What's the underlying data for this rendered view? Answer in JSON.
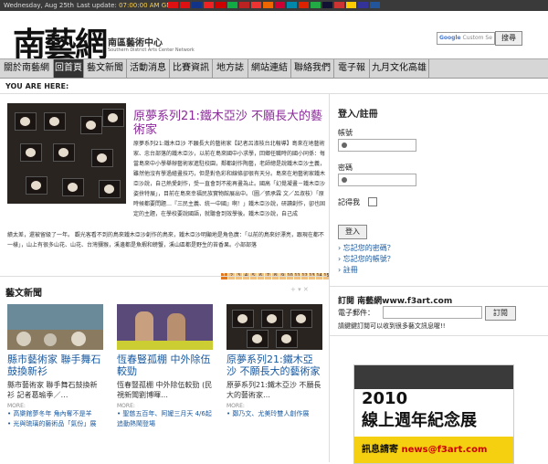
{
  "topbar": {
    "date": "Wednesday, Aug 25th",
    "last_update_label": "Last update:",
    "last_update_time": "07:00:00 AM GMT"
  },
  "flags": [
    "#d11",
    "#d11",
    "#138",
    "#e22",
    "#c00",
    "#1a4",
    "#b22",
    "#e33",
    "#e60",
    "#c03",
    "#08a",
    "#d20",
    "#2a4",
    "#113",
    "#c33",
    "#fc0",
    "#339",
    "#259"
  ],
  "header": {
    "logo_cn": "南藝網",
    "logo_sub": "南區藝術中心",
    "logo_en": "Southern District Arts Center Network",
    "search_placeholder_google": "Google",
    "search_placeholder_rest": " Custom Se",
    "search_button": "搜尋"
  },
  "nav": [
    {
      "label": "關於南藝網",
      "active": false
    },
    {
      "label": "回首頁",
      "active": true
    },
    {
      "label": "藝文新聞",
      "active": false
    },
    {
      "label": "活動消息",
      "active": false
    },
    {
      "label": "比賽資訊",
      "active": false
    },
    {
      "label": "地方誌",
      "active": false
    },
    {
      "label": "網站連結",
      "active": false
    },
    {
      "label": "聯絡我們",
      "active": false
    },
    {
      "label": "電子報",
      "active": false
    },
    {
      "label": "九月文化高雄",
      "active": false
    }
  ],
  "you_are_here": "YOU ARE HERE:",
  "feature": {
    "title": "原夢系列21:鐵木亞沙 不願長大的藝術家",
    "text": "原夢系列21:鐵木亞沙 不願長大的藝術家【記者呂淑枝台北報導】島來在地藝術家、忠台部落的鐵木亞沙，以前在島來國中小求學，回鄉任職時的國小同係：每當島來中小學舉辦藝術家進駐校園，鄰都創作陶藝，老師總是說鐵木亞沙主義，雖然他沒有學過繪畫技巧，但是對色彩和線條卻很有天分。島來在地藝術家鐵木亞沙說，自己熱愛創作，受一直會到不能再畫為止。國高「幻覺凝畫－鐵木亞沙姿拚特展」，目前在島來幸福民族實物館展出中。（圖／張承霖 文／呂淑枝）「原時候都要問題…『三民主義、統一中國』啊！」鐵木亞沙說，研讀創作，卻也固定的主題，在學校要說國語，就聽會到效學後。鐵木亞沙說，自己成",
    "text2": "績太差，還被留級了一年。 觀光客看不到的鳥來鐵木亞沙創作的鳥來，鐵木亞沙明顯地是角色廣：「以前的鳥來好漂亮，跟現在都不一樣」，山上有很多山花、山花、台灣獼猴，溪邊都是魚蝦和螃蟹，溪山區都是野生的苔香果。小部部落"
  },
  "pager": [
    "1",
    "2",
    "3",
    "4",
    "5",
    "6",
    "7",
    "8",
    "9",
    "10",
    "11",
    "12",
    "13",
    "14",
    "15"
  ],
  "news": {
    "title": "藝文新聞",
    "controls": "+ ▾ ✕",
    "items": [
      {
        "title": "縣市藝術家 聯手舞石鼓換新衫",
        "desc": "縣市藝術家 聯手舞石鼓換新衫 記者葛瑜季／…",
        "more": "MORE:",
        "links": [
          "高樂館夢冬年 角內奪不是羊",
          "光與琉璃的藝術品「氣份」展"
        ]
      },
      {
        "title": "恆春豎孤棚 中外除伍較勁",
        "desc": "恆春豎孤棚 中外除伍較勁 (民視新聞劉博暉…",
        "more": "MORE:",
        "links": [
          "聖慈五百年、阿嬤三月天 4/6起追動熱鬧登場",
          ""
        ]
      },
      {
        "title": "原夢系列21:鐵木亞沙 不願長大的藝術家",
        "desc": "原夢系列21:鐵木亞沙 不願長大的藝術家…",
        "more": "MORE:",
        "links": [
          "鄭乃文、尤美玲雙人創作展",
          ""
        ]
      }
    ]
  },
  "login": {
    "title": "登入/註冊",
    "account_label": "帳號",
    "password_label": "密碼",
    "remember_label": "記得我",
    "login_button": "登入",
    "links": [
      "忘記您的密碼？",
      "忘記您的帳號？",
      "註冊"
    ]
  },
  "subscribe": {
    "title": "訂閱 南藝網www.f3art.com",
    "email_label": "電子郵件：",
    "button": "訂閱",
    "note": "請鍵鍵訂閱可以收到很多藝文訊息喔!!"
  },
  "ad": {
    "year": "2010",
    "headline": "線上週年紀念展",
    "cta_label": "訊息請寄",
    "cta_email": "news@f3art.com"
  }
}
